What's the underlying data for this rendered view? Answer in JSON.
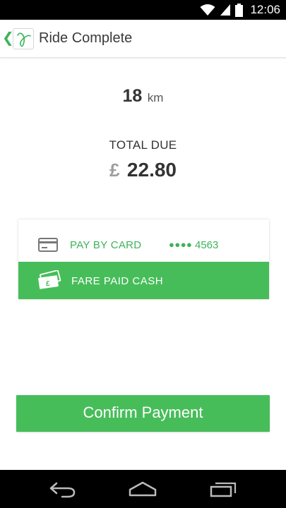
{
  "status_bar": {
    "time": "12:06",
    "icons": [
      "wifi-icon",
      "signal-icon",
      "battery-icon"
    ]
  },
  "app_bar": {
    "title": "Ride Complete",
    "icons": [
      "back-chevron-icon",
      "app-logo-icon"
    ]
  },
  "ride": {
    "distance_value": "18",
    "distance_unit": "km",
    "total_label": "TOTAL DUE",
    "currency_symbol": "£",
    "total_amount": "22.80"
  },
  "payment": {
    "pay_by_card_label": "PAY BY CARD",
    "card_mask": "●●●●",
    "card_last4": "4563",
    "fare_paid_cash_label": "FARE PAID CASH",
    "selected": "fare_paid_cash"
  },
  "confirm_button_label": "Confirm Payment",
  "nav_bar": {
    "icons": [
      "back-icon",
      "home-icon",
      "recents-icon"
    ]
  },
  "colors": {
    "accent": "#47bd5a",
    "accent_text": "#3cb35a",
    "status_bar": "#000000",
    "currency_grey": "#9e9e9e"
  }
}
